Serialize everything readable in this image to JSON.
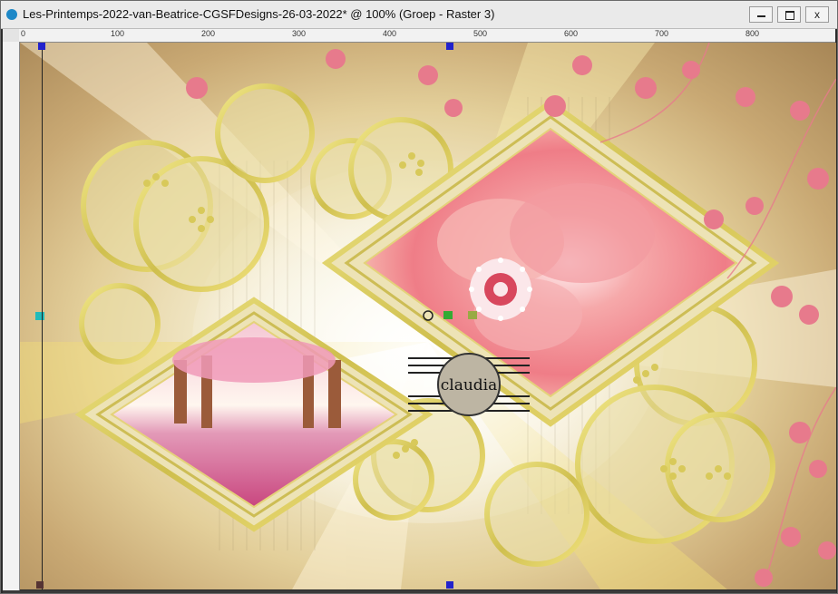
{
  "window": {
    "title": "Les-Printemps-2022-van-Beatrice-CGSFDesigns-26-03-2022* @ 100% (Groep - Raster 3)",
    "buttons": {
      "minimize": "minimize",
      "maximize": "maximize",
      "close": "x"
    }
  },
  "ruler": {
    "h_labels": [
      "0",
      "100",
      "200",
      "300",
      "400",
      "500",
      "600",
      "700",
      "800"
    ]
  },
  "canvas": {
    "watermark": "claudia",
    "colors": {
      "gold": "#d8c95a",
      "cream": "#f6efd6",
      "pink": "#e77a8c",
      "rose": "#f3a3a6",
      "tan": "#b89060"
    }
  }
}
